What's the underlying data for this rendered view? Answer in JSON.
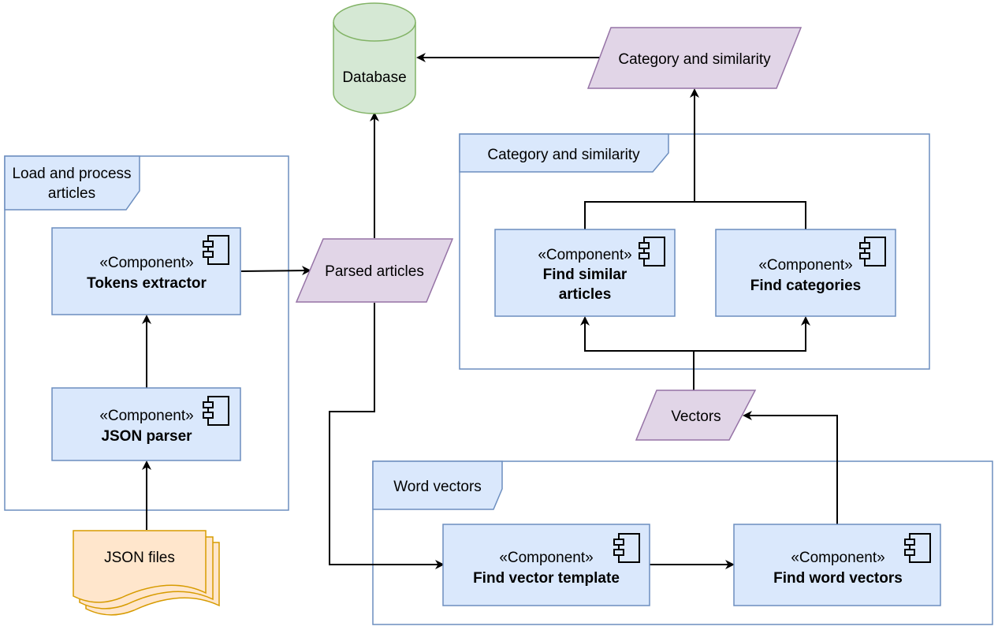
{
  "colors": {
    "component_fill": "#dae8fc",
    "component_stroke": "#6c8ebf",
    "data_fill": "#e1d5e7",
    "data_stroke": "#9673a6",
    "db_fill": "#d5e8d4",
    "db_stroke": "#82b366",
    "file_fill": "#ffe6cc",
    "file_stroke": "#d79b00",
    "edge": "#000000"
  },
  "stereotype": "«Component»",
  "groups": {
    "load": {
      "title_line1": "Load and process",
      "title_line2": "articles"
    },
    "category": {
      "title": "Category and similarity"
    },
    "word": {
      "title": "Word vectors"
    }
  },
  "components": {
    "tokens": {
      "name": "Tokens extractor"
    },
    "json_parser": {
      "name": "JSON parser"
    },
    "find_similar": {
      "name_line1": "Find similar",
      "name_line2": "articles"
    },
    "find_categories": {
      "name": "Find categories"
    },
    "vector_template": {
      "name": "Find vector template"
    },
    "word_vectors": {
      "name": "Find word vectors"
    }
  },
  "data_nodes": {
    "parsed_articles": "Parsed articles",
    "category_similarity": "Category and similarity",
    "vectors": "Vectors"
  },
  "database": {
    "label": "Database"
  },
  "files": {
    "label": "JSON files"
  }
}
